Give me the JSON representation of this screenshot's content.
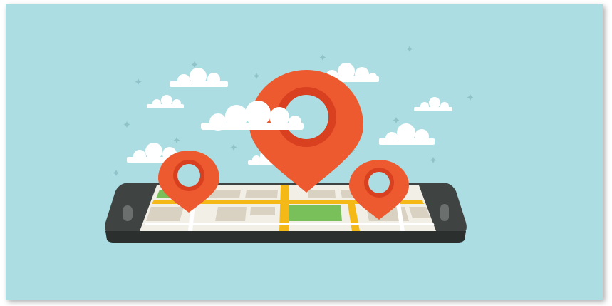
{
  "illustration": {
    "subject": "map-location-illustration",
    "colors": {
      "background": "#acdde2",
      "pin": "#ee5a2f",
      "pin_inner": "#d8401f",
      "phone_body": "#3f4443",
      "road": "#f5b917",
      "park": "#79c05b",
      "map_base": "#f2efe6",
      "cloud": "#ffffff"
    },
    "icons": [
      "location-pin-icon",
      "smartphone-icon",
      "cloud-icon",
      "sparkle-icon"
    ]
  }
}
